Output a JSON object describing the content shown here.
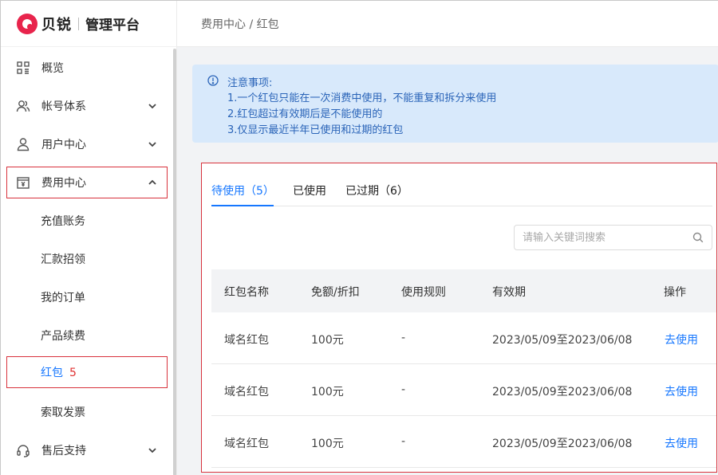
{
  "brand": {
    "name": "贝锐",
    "subtitle": "管理平台",
    "accent": "#e8244c"
  },
  "sidebar": {
    "items": [
      {
        "label": "概览",
        "icon": "grid-icon"
      },
      {
        "label": "帐号体系",
        "icon": "users-icon"
      },
      {
        "label": "用户中心",
        "icon": "user-icon"
      },
      {
        "label": "费用中心",
        "icon": "billing-icon",
        "expanded": true
      },
      {
        "label": "售后支持",
        "icon": "headset-icon"
      }
    ],
    "subitems": [
      {
        "label": "充值账务"
      },
      {
        "label": "汇款招领"
      },
      {
        "label": "我的订单"
      },
      {
        "label": "产品续费"
      },
      {
        "label": "红包",
        "badge": "5",
        "active": true
      },
      {
        "label": "索取发票"
      }
    ]
  },
  "breadcrumb": "费用中心 / 红包",
  "notice": {
    "title": "注意事项:",
    "lines": [
      "1.一个红包只能在一次消费中使用，不能重复和拆分来使用",
      "2.红包超过有效期后是不能使用的",
      "3.仅显示最近半年已使用和过期的红包"
    ]
  },
  "tabs": [
    {
      "label": "待使用（5）",
      "active": true
    },
    {
      "label": "已使用"
    },
    {
      "label": "已过期（6）"
    }
  ],
  "search": {
    "placeholder": "请输入关键词搜索"
  },
  "table": {
    "columns": [
      "红包名称",
      "免额/折扣",
      "使用规则",
      "有效期",
      "操作"
    ],
    "rows": [
      {
        "name": "域名红包",
        "amount": "100元",
        "rule": "-",
        "validity": "2023/05/09至2023/06/08",
        "action": "去使用"
      },
      {
        "name": "域名红包",
        "amount": "100元",
        "rule": "-",
        "validity": "2023/05/09至2023/06/08",
        "action": "去使用"
      },
      {
        "name": "域名红包",
        "amount": "100元",
        "rule": "-",
        "validity": "2023/05/09至2023/06/08",
        "action": "去使用"
      }
    ]
  },
  "colors": {
    "primary": "#1677ff",
    "highlight_box": "#d8323c",
    "notice_bg": "#d8e9fb",
    "notice_text": "#2a64b8"
  }
}
